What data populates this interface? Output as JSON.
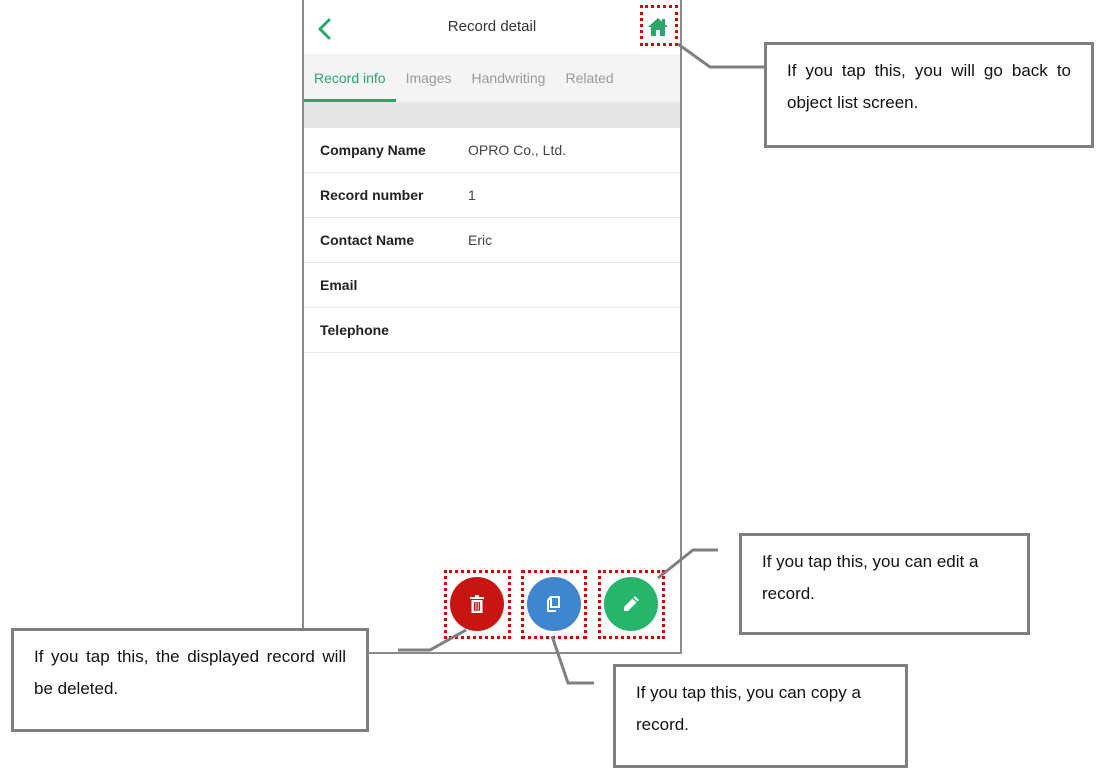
{
  "screen": {
    "title": "Record detail",
    "back_icon": "chevron-left-icon",
    "home_icon": "home-icon",
    "accent_color": "#2aa66a",
    "tabs": [
      {
        "label": "Record info",
        "active": true
      },
      {
        "label": "Images",
        "active": false
      },
      {
        "label": "Handwriting",
        "active": false
      },
      {
        "label": "Related",
        "active": false
      }
    ],
    "fields": [
      {
        "label": "Company Name",
        "value": "OPRO Co., Ltd."
      },
      {
        "label": "Record number",
        "value": "1"
      },
      {
        "label": "Contact Name",
        "value": "Eric"
      },
      {
        "label": "Email",
        "value": ""
      },
      {
        "label": "Telephone",
        "value": ""
      }
    ],
    "actions": {
      "delete": {
        "icon": "trash-icon",
        "color": "#c91414"
      },
      "copy": {
        "icon": "copy-icon",
        "color": "#3f86cf"
      },
      "edit": {
        "icon": "pencil-icon",
        "color": "#27b46b"
      }
    }
  },
  "callouts": {
    "home": "If you tap this, you will go back to object list screen.",
    "edit": "If you tap this, you can edit a record.",
    "delete": "If you tap this, the displayed record will be deleted.",
    "copy": "If you tap this, you can copy a record."
  }
}
